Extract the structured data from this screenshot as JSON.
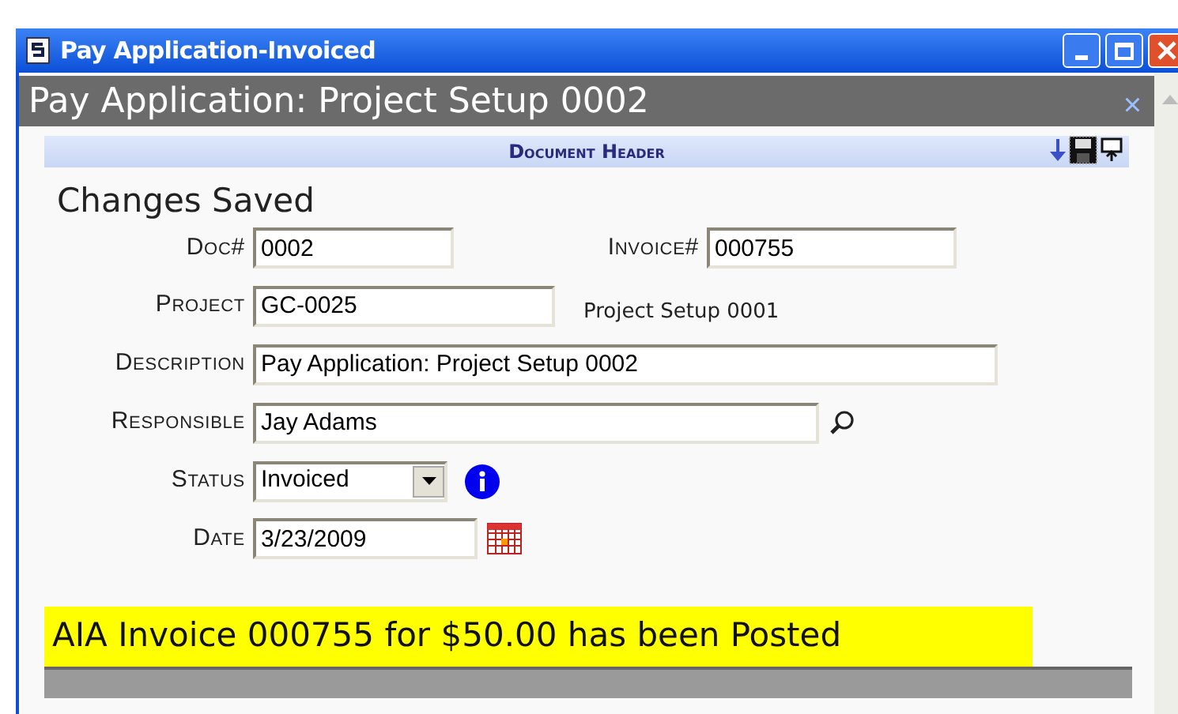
{
  "window": {
    "title": "Pay Application-Invoiced"
  },
  "panel": {
    "title": "Pay Application: Project Setup 0002",
    "close": "×"
  },
  "section": {
    "title": "Document Header"
  },
  "message": "Changes Saved",
  "rows": [
    {
      "kind": "pair",
      "label": "Doc#",
      "value": "0002",
      "label2": "Invoice#",
      "value2": "000755"
    },
    {
      "kind": "note",
      "label": "Project",
      "value": "GC-0025",
      "note": "Project Setup 0001"
    },
    {
      "kind": "wide",
      "label": "Description",
      "value": "Pay Application: Project Setup 0002"
    },
    {
      "kind": "lookup",
      "label": "Responsible",
      "value": "Jay Adams"
    },
    {
      "kind": "select",
      "label": "Status",
      "value": "Invoiced"
    },
    {
      "kind": "date",
      "label": "Date",
      "value": "3/23/2009"
    }
  ],
  "banner": "AIA Invoice 000755 for $50.00 has been Posted"
}
